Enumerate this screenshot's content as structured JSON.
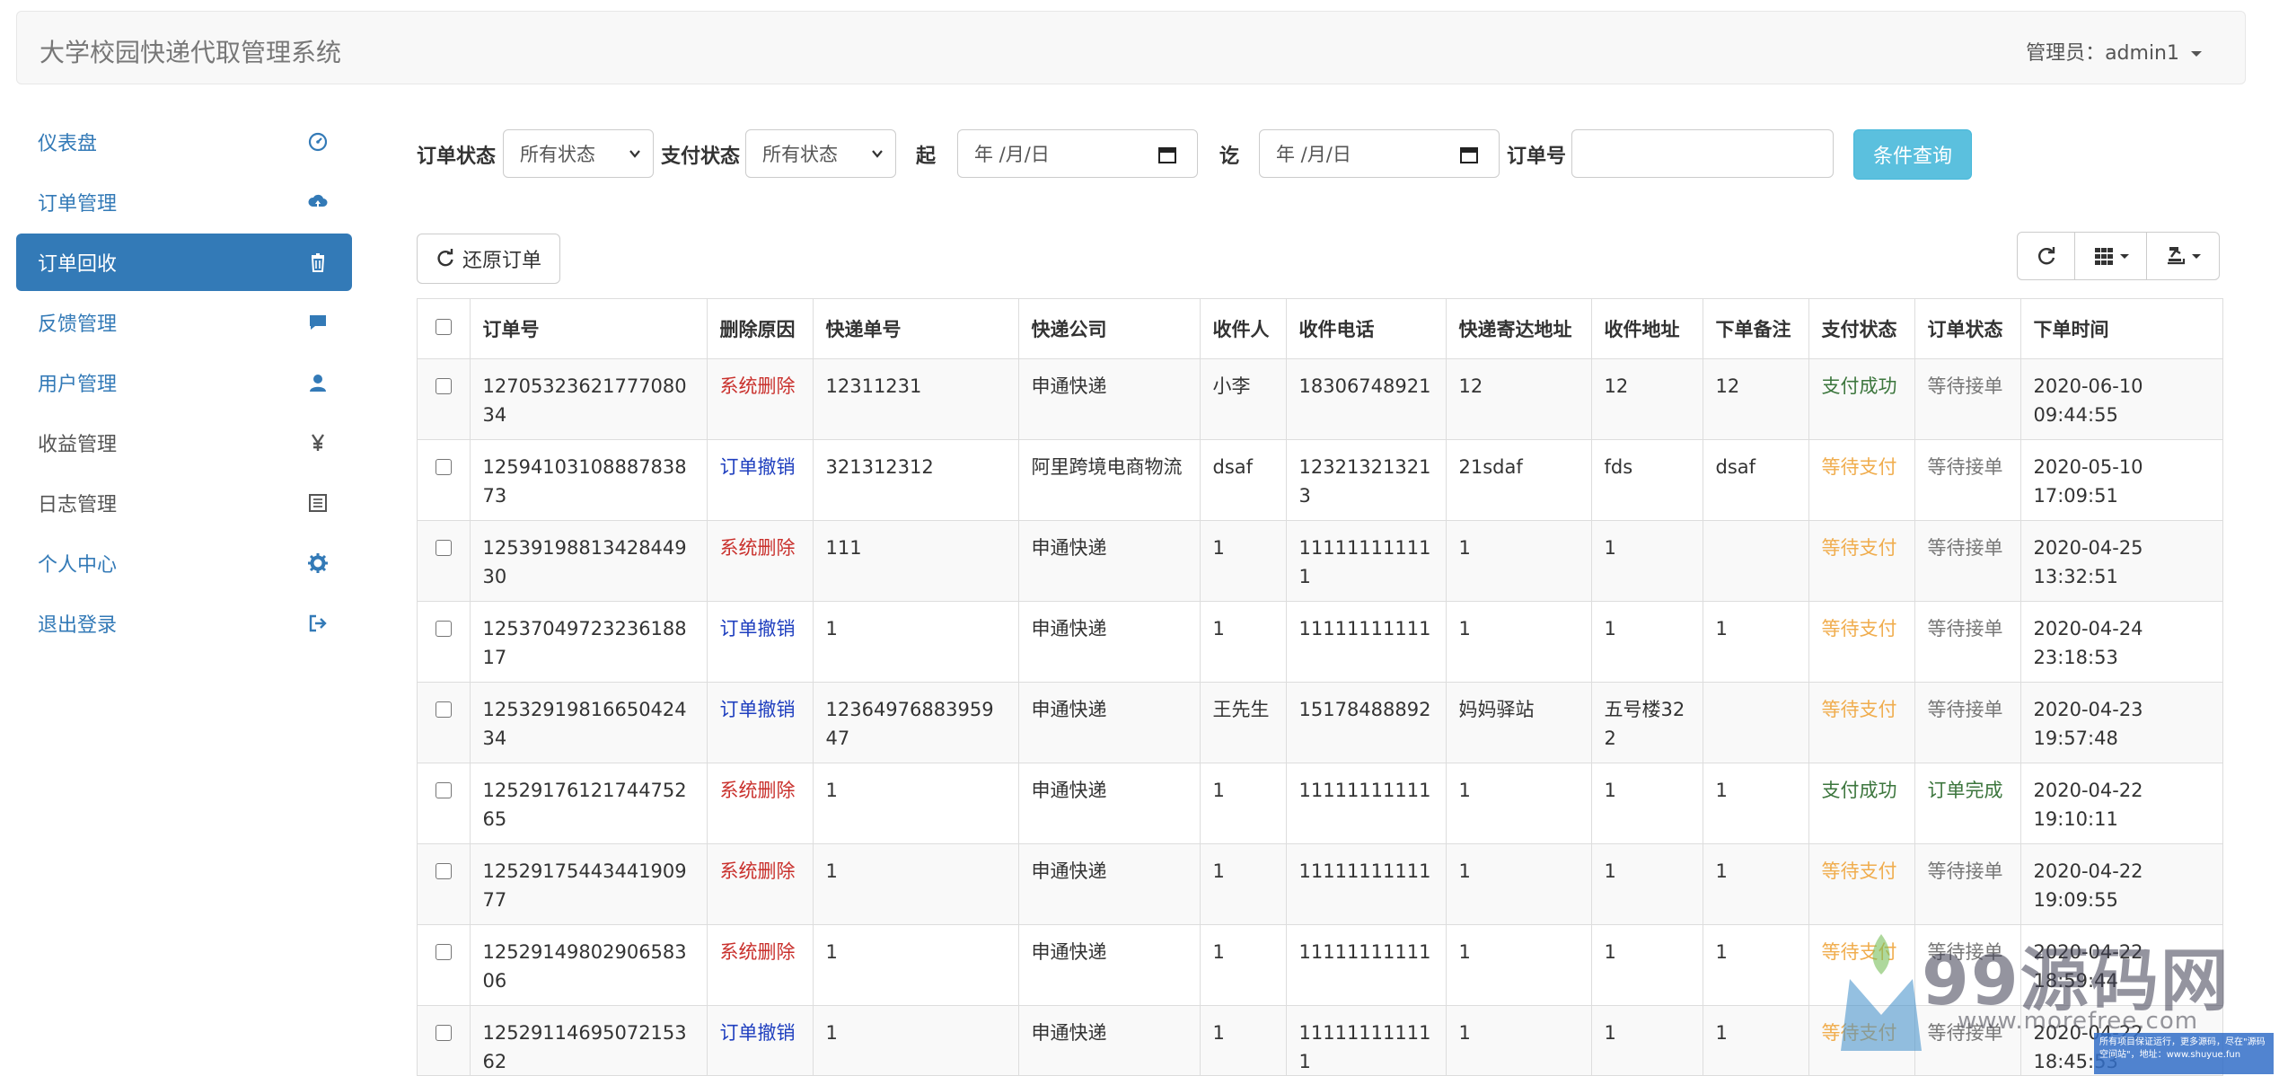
{
  "navbar": {
    "brand": "大学校园快递代取管理系统",
    "admin_label": "管理员：admin1"
  },
  "sidebar": {
    "items": [
      {
        "label": "仪表盘",
        "icon": "dashboard-icon",
        "state": "link"
      },
      {
        "label": "订单管理",
        "icon": "cloud-upload-icon",
        "state": "link"
      },
      {
        "label": "订单回收",
        "icon": "trash-icon",
        "state": "active"
      },
      {
        "label": "反馈管理",
        "icon": "comment-icon",
        "state": "link"
      },
      {
        "label": "用户管理",
        "icon": "user-icon",
        "state": "link"
      },
      {
        "label": "收益管理",
        "icon": "yen-icon",
        "state": "muted"
      },
      {
        "label": "日志管理",
        "icon": "list-alt-icon",
        "state": "muted"
      },
      {
        "label": "个人中心",
        "icon": "cog-icon",
        "state": "link"
      },
      {
        "label": "退出登录",
        "icon": "logout-icon",
        "state": "link"
      }
    ]
  },
  "filters": {
    "order_status_label": "订单状态",
    "order_status_value": "所有状态",
    "pay_status_label": "支付状态",
    "pay_status_value": "所有状态",
    "from_label": "起",
    "from_placeholder": "年 /月/日",
    "to_label": "讫",
    "to_placeholder": "年 /月/日",
    "order_no_label": "订单号",
    "order_no_value": "",
    "search_button": "条件查询"
  },
  "toolbar": {
    "restore_button": "还原订单",
    "refresh_icon": "refresh-icon",
    "columns_icon": "th-icon",
    "export_icon": "export-icon"
  },
  "colors": {
    "accent": "#337ab7",
    "info": "#5bc0de",
    "success": "#3c763d",
    "warning": "#f0ad4e",
    "danger": "#c9302c"
  },
  "table": {
    "columns": [
      "订单号",
      "删除原因",
      "快递单号",
      "快递公司",
      "收件人",
      "收件电话",
      "快递寄达地址",
      "收件地址",
      "下单备注",
      "支付状态",
      "订单状态",
      "下单时间"
    ],
    "rows": [
      {
        "order_no": "1270532362177708034",
        "reason": "系统删除",
        "tracking": "12311231",
        "company": "申通快递",
        "receiver": "小李",
        "phone": "18306748921",
        "delivery_addr": "12",
        "receive_addr": "12",
        "remark": "12",
        "pay_status": "支付成功",
        "order_status": "等待接单",
        "date": "2020-06-10",
        "time": "09:44:55"
      },
      {
        "order_no": "1259410310888783873",
        "reason": "订单撤销",
        "tracking": "321312312",
        "company": "阿里跨境电商物流",
        "receiver": "dsaf",
        "phone": "123213213213",
        "delivery_addr": "21sdaf",
        "receive_addr": "fds",
        "remark": "dsaf",
        "pay_status": "等待支付",
        "order_status": "等待接单",
        "date": "2020-05-10",
        "time": "17:09:51"
      },
      {
        "order_no": "1253919881342844930",
        "reason": "系统删除",
        "tracking": "111",
        "company": "申通快递",
        "receiver": "1",
        "phone": "111111111111",
        "delivery_addr": "1",
        "receive_addr": "1",
        "remark": "",
        "pay_status": "等待支付",
        "order_status": "等待接单",
        "date": "2020-04-25",
        "time": "13:32:51"
      },
      {
        "order_no": "1253704972323618817",
        "reason": "订单撤销",
        "tracking": "1",
        "company": "申通快递",
        "receiver": "1",
        "phone": "11111111111",
        "delivery_addr": "1",
        "receive_addr": "1",
        "remark": "1",
        "pay_status": "等待支付",
        "order_status": "等待接单",
        "date": "2020-04-24",
        "time": "23:18:53"
      },
      {
        "order_no": "1253291981665042434",
        "reason": "订单撤销",
        "tracking": "1236497688395947",
        "company": "申通快递",
        "receiver": "王先生",
        "phone": "15178488892",
        "delivery_addr": "妈妈驿站",
        "receive_addr": "五号楼322",
        "remark": "",
        "pay_status": "等待支付",
        "order_status": "等待接单",
        "date": "2020-04-23",
        "time": "19:57:48"
      },
      {
        "order_no": "1252917612174475265",
        "reason": "系统删除",
        "tracking": "1",
        "company": "申通快递",
        "receiver": "1",
        "phone": "11111111111",
        "delivery_addr": "1",
        "receive_addr": "1",
        "remark": "1",
        "pay_status": "支付成功",
        "order_status": "订单完成",
        "date": "2020-04-22",
        "time": "19:10:11"
      },
      {
        "order_no": "1252917544344190977",
        "reason": "系统删除",
        "tracking": "1",
        "company": "申通快递",
        "receiver": "1",
        "phone": "11111111111",
        "delivery_addr": "1",
        "receive_addr": "1",
        "remark": "1",
        "pay_status": "等待支付",
        "order_status": "等待接单",
        "date": "2020-04-22",
        "time": "19:09:55"
      },
      {
        "order_no": "1252914980290658306",
        "reason": "系统删除",
        "tracking": "1",
        "company": "申通快递",
        "receiver": "1",
        "phone": "11111111111",
        "delivery_addr": "1",
        "receive_addr": "1",
        "remark": "1",
        "pay_status": "等待支付",
        "order_status": "等待接单",
        "date": "2020-04-22",
        "time": "18:59:44"
      },
      {
        "order_no": "1252911469507215362",
        "reason": "订单撤销",
        "tracking": "1",
        "company": "申通快递",
        "receiver": "1",
        "phone": "111111111111",
        "delivery_addr": "1",
        "receive_addr": "1",
        "remark": "1",
        "pay_status": "等待支付",
        "order_status": "等待接单",
        "date": "2020-04-22",
        "time": "18:45:53"
      }
    ]
  },
  "watermark": {
    "text": "99源码网",
    "url": "www.morefree.com",
    "note": "所有项目保证运行，更多源码，尽在\"源码空间站\"，地址：www.shuyue.fun"
  }
}
